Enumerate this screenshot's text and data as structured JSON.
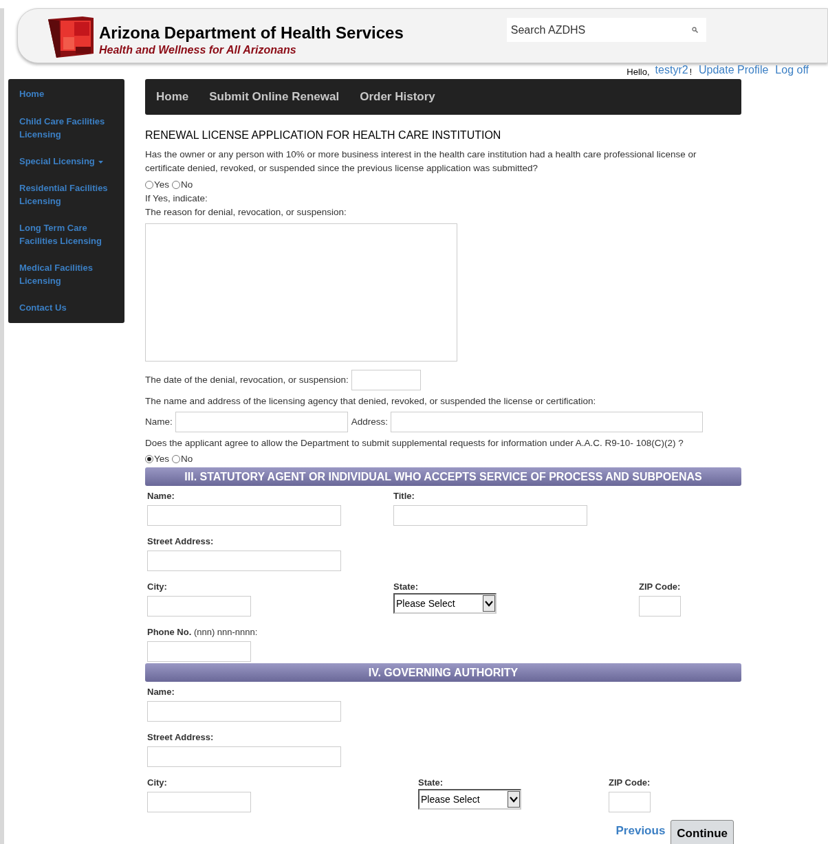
{
  "header": {
    "title": "Arizona Department of Health Services",
    "subtitle": "Health and Wellness for All Arizonans",
    "search": {
      "placeholder": "Search AZDHS"
    }
  },
  "user_bar": {
    "greeting": "Hello,",
    "username": "testyr2",
    "exclamation": "!",
    "links": [
      "Update Profile",
      "Log off"
    ]
  },
  "sidebar": {
    "items": [
      {
        "label": "Home",
        "has_submenu": false
      },
      {
        "label": "Child Care Facilities Licensing",
        "has_submenu": false
      },
      {
        "label": "Special Licensing",
        "has_submenu": true
      },
      {
        "label": "Residential Facilities Licensing",
        "has_submenu": false
      },
      {
        "label": "Long Term Care Facilities Licensing",
        "has_submenu": false
      },
      {
        "label": "Medical Facilities Licensing",
        "has_submenu": false
      },
      {
        "label": "Contact Us",
        "has_submenu": false
      }
    ]
  },
  "nav": {
    "items": [
      "Home",
      "Submit Online Renewal",
      "Order History"
    ]
  },
  "form": {
    "title": "RENEWAL LICENSE APPLICATION FOR HEALTH CARE INSTITUTION",
    "question1": {
      "text": "Has the owner or any person with 10% or more business interest in the health care institution had a health care professional license or certificate denied, revoked, or suspended since the previous license application was submitted?",
      "options": [
        {
          "label": "Yes",
          "selected": false
        },
        {
          "label": "No",
          "selected": false
        }
      ]
    },
    "if_yes": "If Yes, indicate:",
    "reason_label": "The reason for denial, revocation, or suspension:",
    "date_label": "The date of the denial, revocation, or suspension:",
    "agency_label": "The name and address of the licensing agency that denied, revoked, or suspended the license or certification:",
    "agency_name_label": "Name:",
    "agency_address_label": "Address:",
    "question2": {
      "text": "Does the applicant agree to allow the Department to submit supplemental requests for information under A.A.C. R9-10- 108(C)(2) ?",
      "options": [
        {
          "label": "Yes",
          "selected": true
        },
        {
          "label": "No",
          "selected": false
        }
      ]
    },
    "sections": [
      {
        "title": "III. STATUTORY AGENT OR INDIVIDUAL WHO ACCEPTS SERVICE OF PROCESS AND SUBPOENAS",
        "rows": [
          [
            {
              "label": "Name:",
              "kind": "text"
            },
            {
              "label": "Title:",
              "kind": "text"
            }
          ],
          [
            {
              "label": "Street Address:",
              "kind": "text"
            }
          ],
          [
            {
              "label": "City:",
              "kind": "shorttext"
            },
            {
              "label": "State:",
              "kind": "select",
              "value": "Please Select"
            },
            {
              "label": "ZIP Code:",
              "kind": "zip"
            }
          ],
          [
            {
              "label": "**Phone No.** (nnn) nnn-nnnn:",
              "kind": "shorttext"
            }
          ]
        ]
      },
      {
        "title": "IV. GOVERNING AUTHORITY",
        "rows": [
          [
            {
              "label": "Name:",
              "kind": "text"
            }
          ],
          [
            {
              "label": "Street Address:",
              "kind": "text"
            }
          ],
          [
            {
              "label": "City:",
              "kind": "shorttext"
            },
            {
              "label": "State:",
              "kind": "select",
              "value": "Please Select"
            },
            {
              "label": "ZIP Code:",
              "kind": "zip"
            }
          ]
        ]
      }
    ],
    "previous": "Previous",
    "continue": "Continue"
  }
}
